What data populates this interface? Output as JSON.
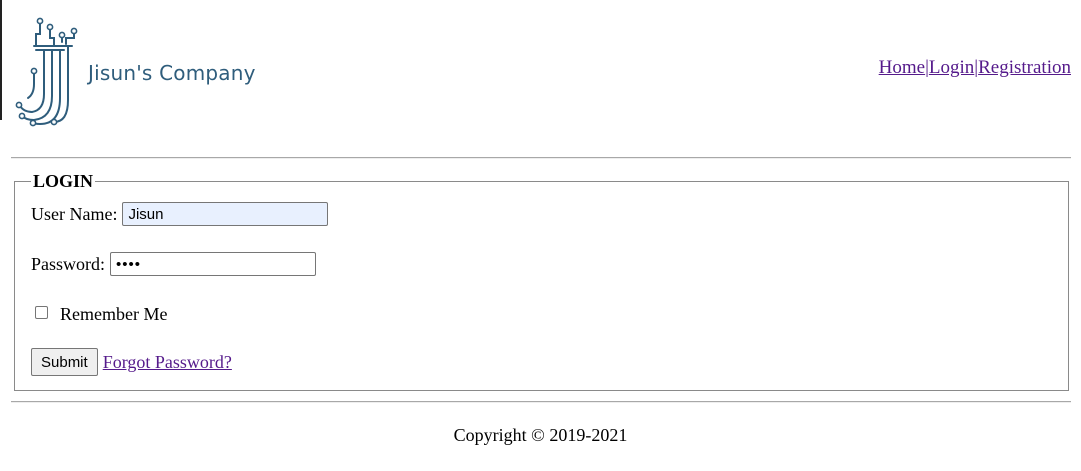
{
  "brand": {
    "company_name": "Jisun's Company",
    "logo_color": "#2f5d7c"
  },
  "nav": {
    "home": "Home",
    "login": "Login",
    "registration": "Registration",
    "separator": "|",
    "link_color": "#551a8b"
  },
  "login_form": {
    "legend": "LOGIN",
    "username_label": "User Name:",
    "username_value": "Jisun",
    "password_label": "Password:",
    "password_value": "••••",
    "remember_label": "Remember Me",
    "remember_checked": false,
    "submit_label": "Submit",
    "forgot_label": "Forgot Password?"
  },
  "footer": {
    "copyright": "Copyright © 2019-2021"
  }
}
